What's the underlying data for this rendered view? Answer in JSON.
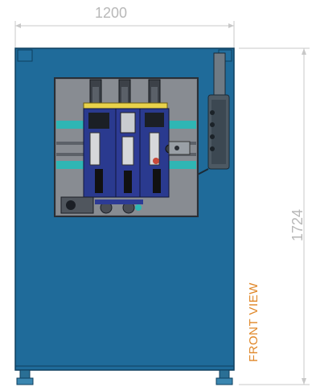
{
  "dimensions": {
    "width_label": "1200",
    "height_label": "1724"
  },
  "view_label": "FRONT VIEW",
  "colors": {
    "cabinet": "#1f6b9a",
    "cabinet_edge": "#15557d",
    "window_bg": "#7b7f86",
    "window_frame": "#2a2f36",
    "teal_rail": "#2fb6b4",
    "yellow_plate": "#e8d24a",
    "dimension_line": "#c8c8c8",
    "view_label": "#e0882a"
  },
  "icons": {
    "feet": "leveling-foot-icon",
    "handle": "door-handle-icon",
    "corner": "corner-bracket-icon"
  }
}
